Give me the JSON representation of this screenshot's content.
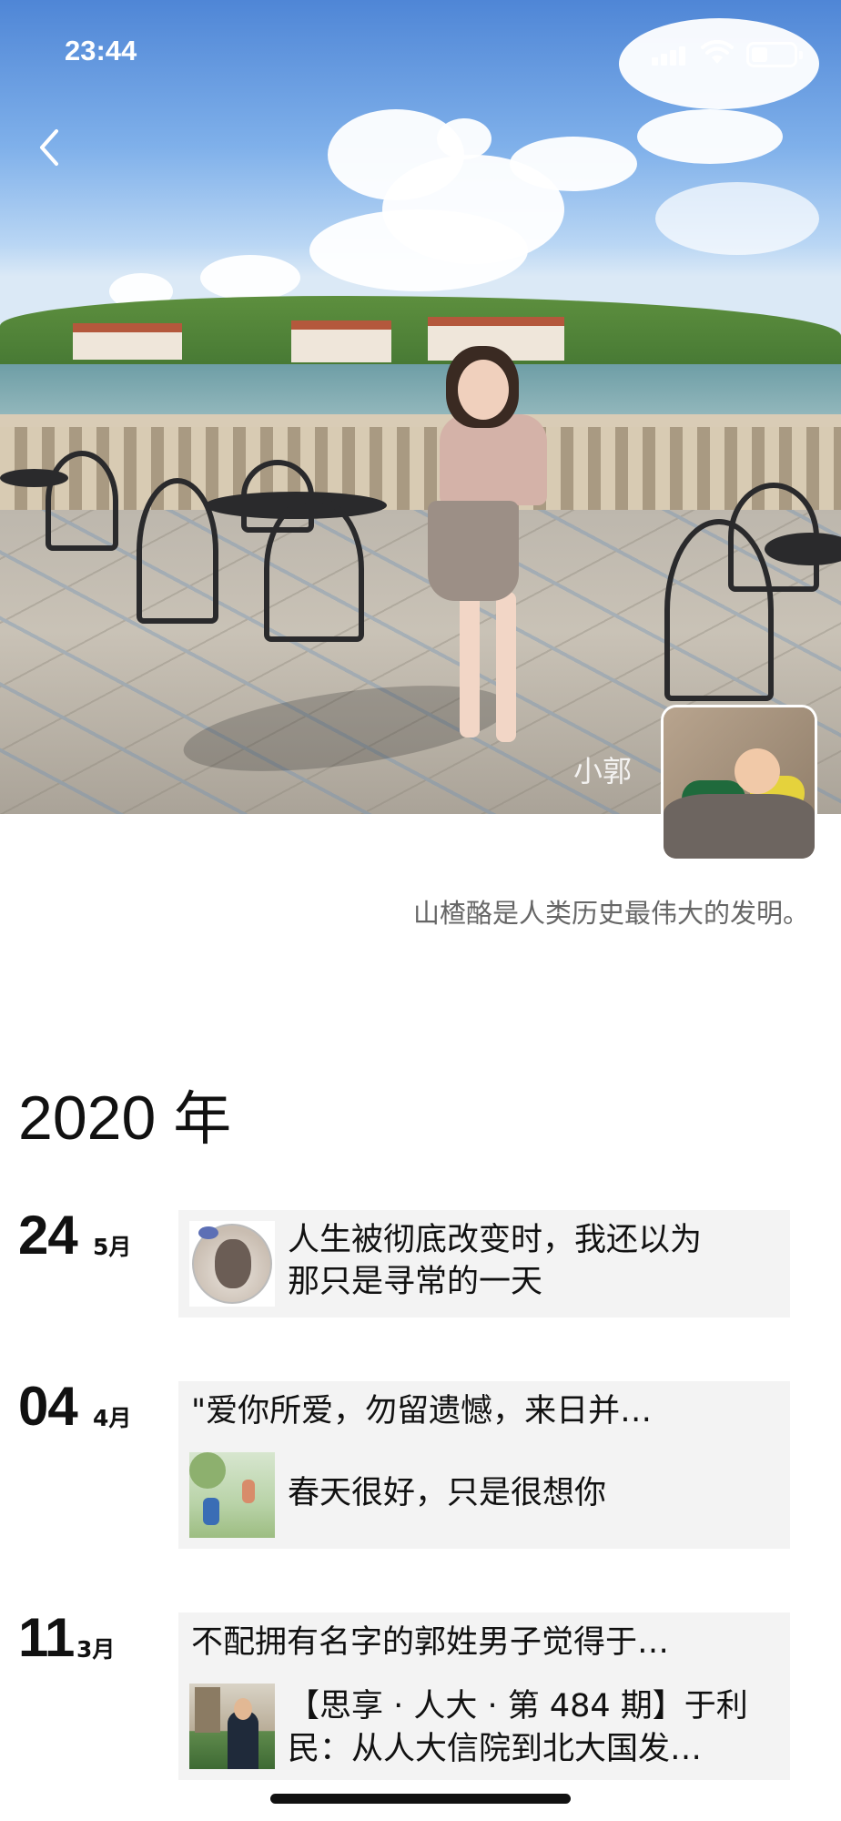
{
  "status_bar": {
    "time": "23:44"
  },
  "cover": {
    "watermark": "小郭"
  },
  "profile": {
    "signature": "山楂酪是人类历史最伟大的发明。"
  },
  "timeline": {
    "year": "2020",
    "year_unit": "年",
    "entries": [
      {
        "day": "24",
        "month": "5月",
        "lines": [
          "人生被彻底改变时，我还以为",
          "那只是寻常的一天"
        ],
        "thumb": "girl-portrait"
      },
      {
        "day": "04",
        "month": "4月",
        "title": "\"爱你所爱，勿留遗憾，来日并…",
        "lines": [
          "春天很好，只是很想你"
        ],
        "thumb": "park-illustration"
      },
      {
        "day": "11",
        "month": "3月",
        "title": "不配拥有名字的郭姓男子觉得于…",
        "lines": [
          "【思享 · 人大 · 第 484 期】于利",
          "民：从人大信院到北大国发…"
        ],
        "thumb": "campus-photo"
      }
    ]
  },
  "icons": [
    "back-icon",
    "signal-icon",
    "wifi-icon",
    "battery-icon"
  ],
  "colors": {
    "card_bg": "#f3f3f3",
    "signature_text": "#666666"
  }
}
